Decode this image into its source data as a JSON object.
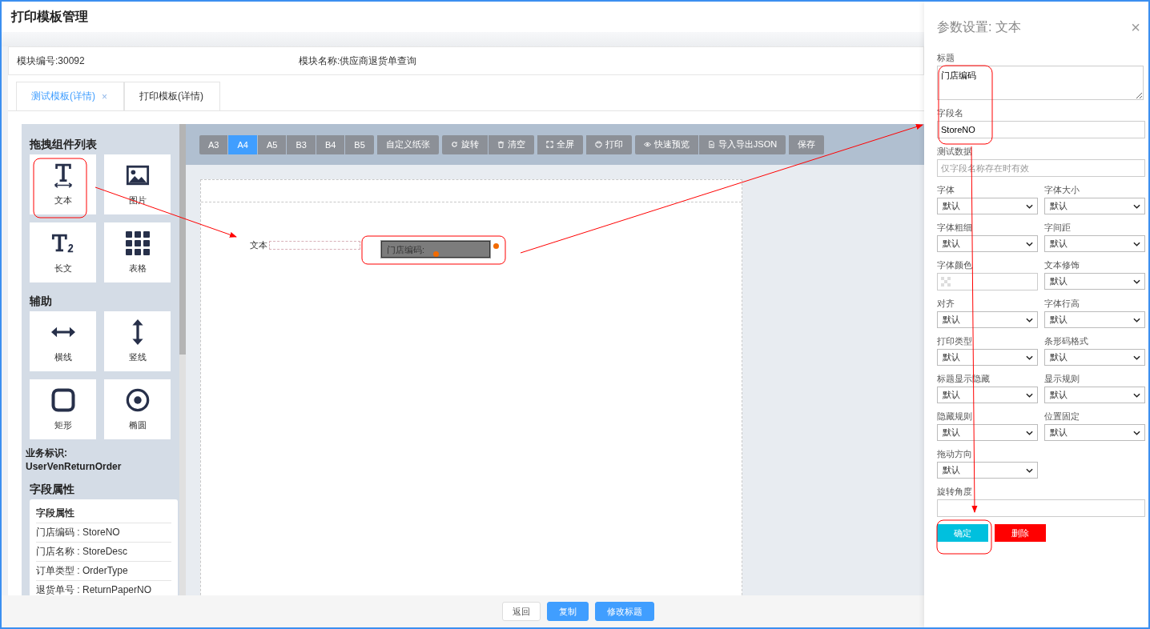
{
  "window": {
    "title": "打印模板管理"
  },
  "module_info": {
    "number": "模块编号:30092",
    "name": "模块名称:供应商退货单查询"
  },
  "tabs": [
    {
      "label": "测试模板(详情)",
      "selected": true,
      "close": "×"
    },
    {
      "label": "打印模板(详情)",
      "selected": false
    }
  ],
  "palette": {
    "sections": [
      {
        "title": "拖拽组件列表",
        "items": [
          {
            "label": "文本",
            "kind": "text"
          },
          {
            "label": "图片",
            "kind": "image"
          },
          {
            "label": "长文",
            "kind": "longtext"
          },
          {
            "label": "表格",
            "kind": "table"
          }
        ]
      },
      {
        "title": "辅助",
        "items": [
          {
            "label": "横线",
            "kind": "hline"
          },
          {
            "label": "竖线",
            "kind": "vline"
          },
          {
            "label": "矩形",
            "kind": "rect"
          },
          {
            "label": "椭圆",
            "kind": "ellipse"
          }
        ]
      }
    ],
    "business_id": {
      "label": "业务标识:",
      "value": "UserVenReturnOrder"
    },
    "field_props": {
      "title": "字段属性",
      "header": "字段属性",
      "rows": [
        "门店编码 : StoreNO",
        "门店名称 : StoreDesc",
        "订单类型 : OrderType",
        "退货单号 : ReturnPaperNO"
      ]
    }
  },
  "toolbar": [
    {
      "buttons": [
        {
          "label": "A3",
          "selected": false
        },
        {
          "label": "A4",
          "selected": true
        },
        {
          "label": "A5",
          "selected": false
        },
        {
          "label": "B3",
          "selected": false
        },
        {
          "label": "B4",
          "selected": false
        },
        {
          "label": "B5",
          "selected": false
        }
      ]
    },
    {
      "buttons": [
        {
          "label": "自定义纸张",
          "selected": false
        }
      ]
    },
    {
      "buttons": [
        {
          "label": "旋转",
          "selected": false
        },
        {
          "label": "清空",
          "selected": false
        }
      ]
    },
    {
      "buttons": [
        {
          "label": "全屏",
          "selected": false
        }
      ]
    },
    {
      "buttons": [
        {
          "label": "打印",
          "selected": false
        }
      ]
    },
    {
      "buttons": [
        {
          "label": "快速预览",
          "selected": false
        },
        {
          "label": "导入导出JSON",
          "selected": false
        }
      ]
    },
    {
      "buttons": [
        {
          "label": "保存",
          "selected": false
        }
      ]
    }
  ],
  "canvas": {
    "elements": [
      {
        "kind": "text",
        "label": "文本"
      },
      {
        "kind": "field",
        "label": "门店编码:",
        "selected": true
      }
    ]
  },
  "settings_panel": {
    "title": "参数设置: 文本",
    "close": "×",
    "fields": [
      {
        "kind": "textarea",
        "label": "标题",
        "value": "门店编码"
      },
      {
        "kind": "input",
        "label": "字段名",
        "value": "StoreNO"
      },
      {
        "kind": "input",
        "label": "测试数据",
        "placeholder": "仅字段名称存在时有效"
      },
      {
        "kind": "select",
        "label": "字体",
        "value": "默认"
      },
      {
        "kind": "select",
        "label": "字体大小",
        "value": "默认"
      },
      {
        "kind": "select",
        "label": "字体粗细",
        "value": "默认"
      },
      {
        "kind": "select",
        "label": "字间距",
        "value": "默认"
      },
      {
        "kind": "color",
        "label": "字体颜色"
      },
      {
        "kind": "select",
        "label": "文本修饰",
        "value": "默认"
      },
      {
        "kind": "select",
        "label": "对齐",
        "value": "默认"
      },
      {
        "kind": "select",
        "label": "字体行高",
        "value": "默认"
      },
      {
        "kind": "select",
        "label": "打印类型",
        "value": "默认"
      },
      {
        "kind": "select",
        "label": "条形码格式",
        "value": "默认"
      },
      {
        "kind": "select",
        "label": "标题显示隐藏",
        "value": "默认"
      },
      {
        "kind": "select",
        "label": "显示规则",
        "value": "默认"
      },
      {
        "kind": "select",
        "label": "隐藏规则",
        "value": "默认"
      },
      {
        "kind": "select",
        "label": "位置固定",
        "value": "默认"
      },
      {
        "kind": "select",
        "label": "拖动方向",
        "value": "默认"
      },
      {
        "kind": "input",
        "label": "旋转角度"
      }
    ],
    "buttons": [
      {
        "label": "确定",
        "kind": "primary"
      },
      {
        "label": "删除",
        "kind": "danger"
      }
    ]
  },
  "footer": [
    {
      "label": "返回",
      "kind": "default"
    },
    {
      "label": "复制",
      "kind": "primary"
    },
    {
      "label": "修改标题",
      "kind": "primary"
    }
  ]
}
